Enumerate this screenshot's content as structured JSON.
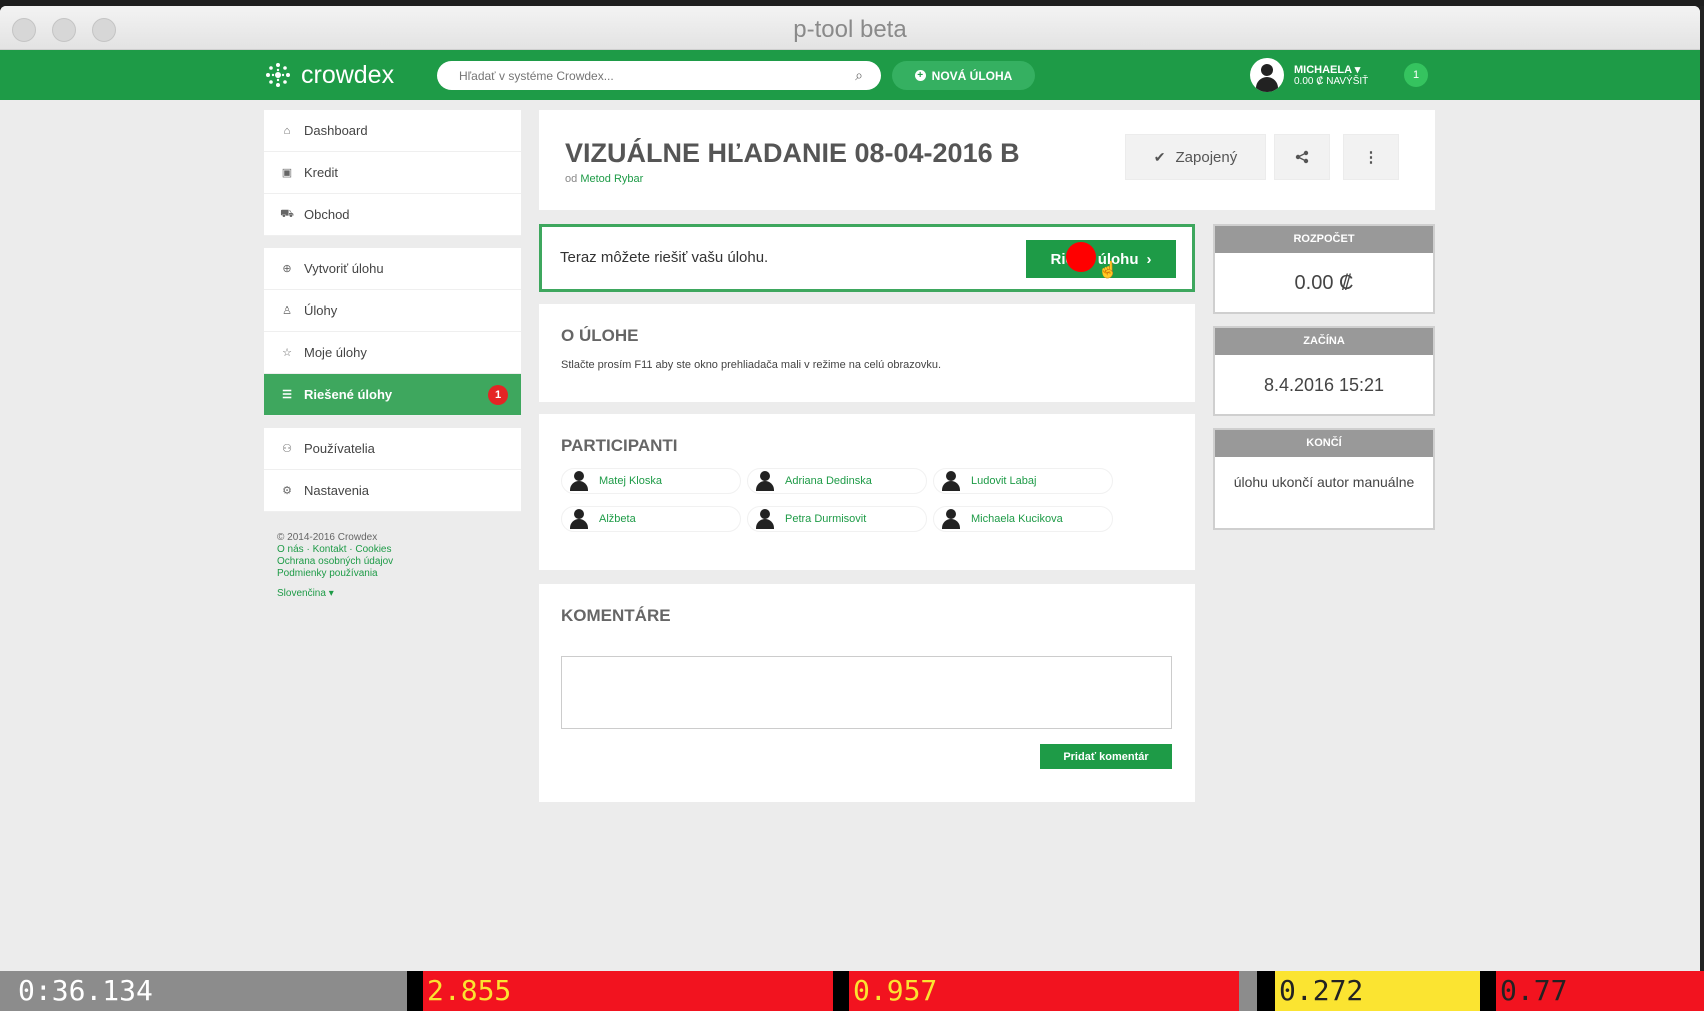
{
  "window": {
    "title": "p-tool beta"
  },
  "app": {
    "logo_text": "crowdex"
  },
  "header": {
    "search_placeholder": "Hľadať v systéme Crowdex...",
    "new_task_label": "NOVÁ ÚLOHA",
    "user_name": "MICHAELA",
    "user_balance": "0.00 ₡ NAVÝŠIŤ",
    "notification_count": "1"
  },
  "sidebar": {
    "group1": [
      {
        "label": "Dashboard",
        "icon": "home-icon",
        "glyph": "⌂"
      },
      {
        "label": "Kredit",
        "icon": "money-icon",
        "glyph": "▣"
      },
      {
        "label": "Obchod",
        "icon": "cart-icon",
        "glyph": "⛟"
      }
    ],
    "group2": [
      {
        "label": "Vytvoriť úlohu",
        "icon": "plus-circle-icon",
        "glyph": "⊕"
      },
      {
        "label": "Úlohy",
        "icon": "flask-icon",
        "glyph": "♙"
      },
      {
        "label": "Moje úlohy",
        "icon": "star-icon",
        "glyph": "☆"
      },
      {
        "label": "Riešené úlohy",
        "icon": "list-icon",
        "glyph": "☰",
        "badge": "1"
      }
    ],
    "group3": [
      {
        "label": "Používatelia",
        "icon": "users-icon",
        "glyph": "⚇"
      },
      {
        "label": "Nastavenia",
        "icon": "gear-icon",
        "glyph": "⚙"
      }
    ],
    "footer": {
      "copyright": "© 2014-2016 Crowdex",
      "links": "O nás  ·  Kontakt  ·  Cookies",
      "privacy": "Ochrana osobných údajov",
      "terms": "Podmienky používania",
      "language": "Slovenčina ▾"
    }
  },
  "task": {
    "title": "VIZUÁLNE HĽADANIE 08-04-2016 B",
    "author_prefix": "od",
    "author": "Metod Rybar",
    "joined_label": "Zapojený",
    "solve_prompt": "Teraz môžete riešiť vašu úlohu.",
    "solve_button": "Riešiť úlohu"
  },
  "about": {
    "heading": "O ÚLOHE",
    "text": "Stlačte prosím F11 aby ste okno prehliadača mali v režime na celú obrazovku."
  },
  "participants": {
    "heading": "PARTICIPANTI",
    "people": [
      "Matej Kloska",
      "Adriana Dedinska",
      "Ludovit Labaj",
      "Alžbeta",
      "Petra Durmisovit",
      "Michaela Kucikova"
    ]
  },
  "comments": {
    "heading": "KOMENTÁRE",
    "add_button": "Pridať komentár"
  },
  "info": {
    "budget_label": "ROZPOČET",
    "budget_value": "0.00 ₡",
    "start_label": "ZAČÍNA",
    "start_value": "8.4.2016 15:21",
    "end_label": "KONČÍ",
    "end_value": "úlohu ukončí autor manuálne"
  },
  "status_bar": {
    "time": "0:36.134",
    "v1": "2.855",
    "v2": "0.957",
    "v3": "0.272",
    "v4": "0.77",
    "colors": {
      "gray": "#8c8c8c",
      "red": "#f2131f",
      "yellow": "#fbe431"
    }
  }
}
